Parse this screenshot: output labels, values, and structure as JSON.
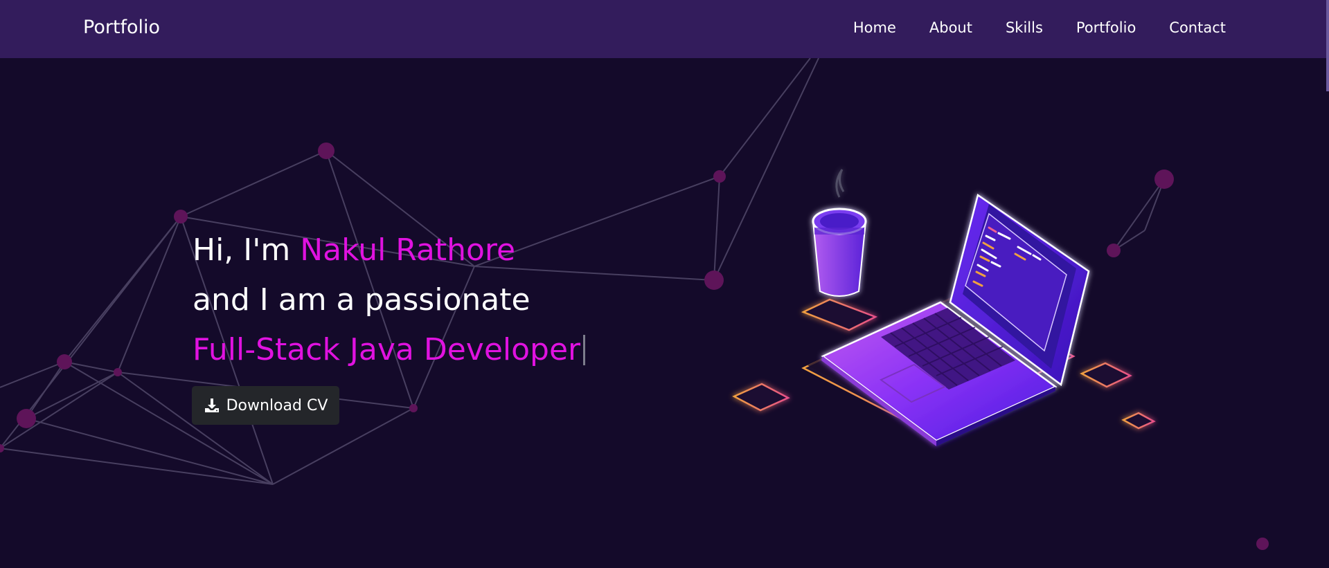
{
  "navbar": {
    "brand": "Portfolio",
    "links": [
      "Home",
      "About",
      "Skills",
      "Portfolio",
      "Contact"
    ]
  },
  "hero": {
    "greeting": "Hi, I'm ",
    "name": "Nakul Rathore",
    "line2": "and I am a passionate",
    "role": "Full-Stack Java Developer"
  },
  "cv_button": {
    "label": "Download CV",
    "icon": "download-icon"
  },
  "illustration": {
    "icon": "laptop-coffee-illustration"
  },
  "colors": {
    "background": "#140a2a",
    "navbar": "#331c5c",
    "accent": "#e012e0",
    "button": "#24262a",
    "network_line": "#4e4566",
    "network_node": "#5e1459"
  }
}
